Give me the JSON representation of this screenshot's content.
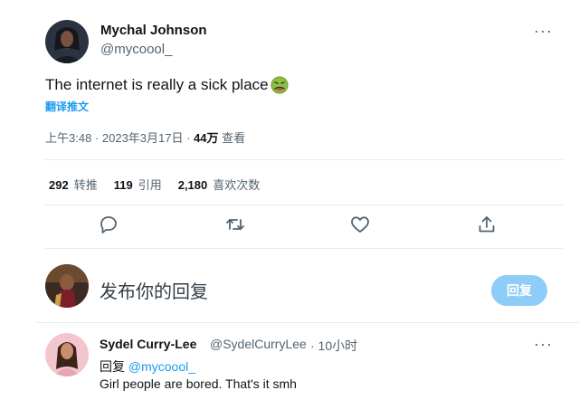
{
  "tweet": {
    "author_name": "Mychal Johnson",
    "author_handle": "@mycoool_",
    "text": "The internet is really a sick place",
    "emoji_icon": "nauseated-face-icon",
    "translate_label": "翻译推文",
    "time": "上午3:48",
    "separator": " · ",
    "date": "2023年3月17日",
    "views_count": "44万",
    "views_label": "查看",
    "stats": [
      {
        "count": "292",
        "label": "转推"
      },
      {
        "count": "119",
        "label": "引用"
      },
      {
        "count": "2,180",
        "label": "喜欢次数"
      }
    ],
    "actions": [
      "reply-icon",
      "retweet-icon",
      "like-icon",
      "share-icon"
    ]
  },
  "compose": {
    "placeholder": "发布你的回复",
    "button_label": "回复"
  },
  "reply": {
    "author_name": "Sydel Curry-Lee",
    "author_handle": "@SydelCurryLee",
    "time": "· 10小时",
    "reply_prefix": "回复",
    "reply_mention": "@mycoool_",
    "text": "Girl people are bored. That's it smh"
  },
  "colors": {
    "accent": "#1d9bf0",
    "reply_button": "#8ecdf7",
    "secondary_text": "#536471"
  }
}
